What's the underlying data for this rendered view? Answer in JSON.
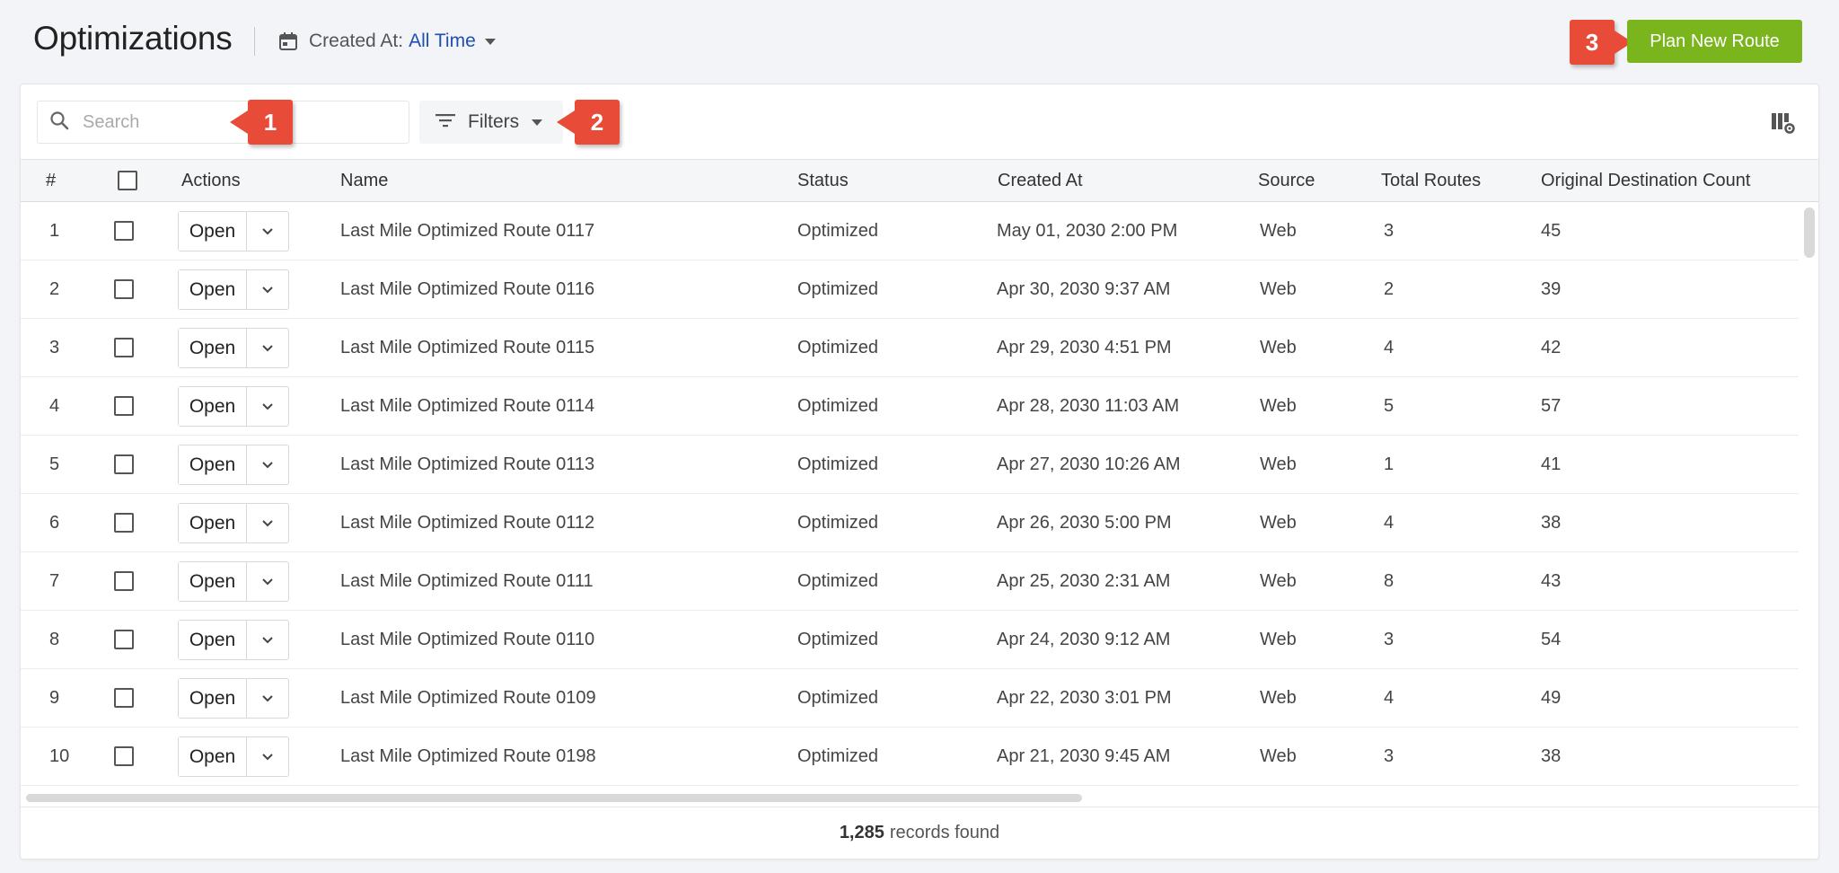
{
  "header": {
    "title": "Optimizations",
    "date_filter_label": "Created At:",
    "date_filter_value": "All Time",
    "plan_button": "Plan New Route"
  },
  "callouts": [
    "1",
    "2",
    "3"
  ],
  "toolbar": {
    "search_placeholder": "Search",
    "filters_label": "Filters"
  },
  "table": {
    "columns": [
      "#",
      "",
      "Actions",
      "Name",
      "Status",
      "Created At",
      "Source",
      "Total Routes",
      "Original Destination Count"
    ],
    "open_label": "Open",
    "rows": [
      {
        "num": "1",
        "name": "Last Mile Optimized Route 0117",
        "status": "Optimized",
        "created": "May 01, 2030 2:00 PM",
        "source": "Web",
        "routes": "3",
        "dest": "45"
      },
      {
        "num": "2",
        "name": "Last Mile Optimized Route 0116",
        "status": "Optimized",
        "created": "Apr 30, 2030 9:37 AM",
        "source": "Web",
        "routes": "2",
        "dest": "39"
      },
      {
        "num": "3",
        "name": "Last Mile Optimized Route 0115",
        "status": "Optimized",
        "created": "Apr 29, 2030 4:51 PM",
        "source": "Web",
        "routes": "4",
        "dest": "42"
      },
      {
        "num": "4",
        "name": "Last Mile Optimized Route 0114",
        "status": "Optimized",
        "created": "Apr 28, 2030 11:03 AM",
        "source": "Web",
        "routes": "5",
        "dest": "57"
      },
      {
        "num": "5",
        "name": "Last Mile Optimized Route 0113",
        "status": "Optimized",
        "created": "Apr 27, 2030 10:26 AM",
        "source": "Web",
        "routes": "1",
        "dest": "41"
      },
      {
        "num": "6",
        "name": "Last Mile Optimized Route 0112",
        "status": "Optimized",
        "created": "Apr 26, 2030 5:00 PM",
        "source": "Web",
        "routes": "4",
        "dest": "38"
      },
      {
        "num": "7",
        "name": "Last Mile Optimized Route 0111",
        "status": "Optimized",
        "created": "Apr 25, 2030 2:31 AM",
        "source": "Web",
        "routes": "8",
        "dest": "43"
      },
      {
        "num": "8",
        "name": "Last Mile Optimized Route 0110",
        "status": "Optimized",
        "created": "Apr 24, 2030 9:12 AM",
        "source": "Web",
        "routes": "3",
        "dest": "54"
      },
      {
        "num": "9",
        "name": "Last Mile Optimized Route 0109",
        "status": "Optimized",
        "created": "Apr 22, 2030 3:01 PM",
        "source": "Web",
        "routes": "4",
        "dest": "49"
      },
      {
        "num": "10",
        "name": "Last Mile Optimized Route 0198",
        "status": "Optimized",
        "created": "Apr 21, 2030 9:45 AM",
        "source": "Web",
        "routes": "3",
        "dest": "38"
      }
    ]
  },
  "footer": {
    "count": "1,285",
    "label": "records found"
  },
  "colors": {
    "accent_green": "#7ab51d",
    "link_blue": "#1f4fb0",
    "callout_red": "#e84b37"
  },
  "icons": [
    "calendar-icon",
    "search-icon",
    "filter-icon",
    "caret-down-icon",
    "chevron-down-icon",
    "column-settings-icon"
  ]
}
